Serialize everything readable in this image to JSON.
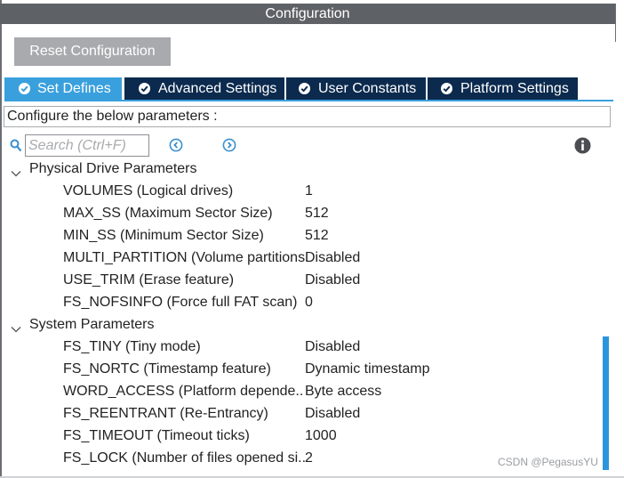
{
  "window": {
    "title": "Configuration"
  },
  "toolbar": {
    "reset_label": "Reset Configuration"
  },
  "tabs": [
    {
      "label": "Set Defines",
      "active": true
    },
    {
      "label": "Advanced Settings",
      "active": false
    },
    {
      "label": "User Constants",
      "active": false
    },
    {
      "label": "Platform Settings",
      "active": false
    }
  ],
  "description": "Configure the below parameters :",
  "search": {
    "placeholder": "Search (Ctrl+F)",
    "value": ""
  },
  "icons": {
    "search": "search-icon",
    "prev": "chevron-left-circle-icon",
    "next": "chevron-right-circle-icon",
    "info": "info-icon",
    "tab_check": "check-circle-icon",
    "group_toggle": "chevron-down-icon"
  },
  "groups": [
    {
      "title": "Physical Drive Parameters",
      "rows": [
        {
          "name": "VOLUMES (Logical drives)",
          "value": "1"
        },
        {
          "name": "MAX_SS (Maximum Sector Size)",
          "value": "512"
        },
        {
          "name": "MIN_SS (Minimum Sector Size)",
          "value": "512"
        },
        {
          "name": "MULTI_PARTITION (Volume partitions.",
          "value": "Disabled"
        },
        {
          "name": "USE_TRIM (Erase feature)",
          "value": "Disabled"
        },
        {
          "name": "FS_NOFSINFO (Force full FAT scan)",
          "value": "0"
        }
      ]
    },
    {
      "title": "System Parameters",
      "rows": [
        {
          "name": "FS_TINY (Tiny mode)",
          "value": "Disabled"
        },
        {
          "name": "FS_NORTC (Timestamp feature)",
          "value": "Dynamic timestamp"
        },
        {
          "name": "WORD_ACCESS (Platform depende..",
          "value": "Byte access"
        },
        {
          "name": "FS_REENTRANT (Re-Entrancy)",
          "value": "Disabled"
        },
        {
          "name": "FS_TIMEOUT (Timeout ticks)",
          "value": "1000"
        },
        {
          "name": "FS_LOCK (Number of files opened si..",
          "value": "2"
        }
      ]
    }
  ],
  "watermark": "CSDN @PegasusYU",
  "colors": {
    "title_bar": "#5e6266",
    "tab_active": "#3aa0dd",
    "tab_inactive": "#0b2a4e",
    "accent": "#2b95dc",
    "button_gray": "#a8aaad"
  }
}
